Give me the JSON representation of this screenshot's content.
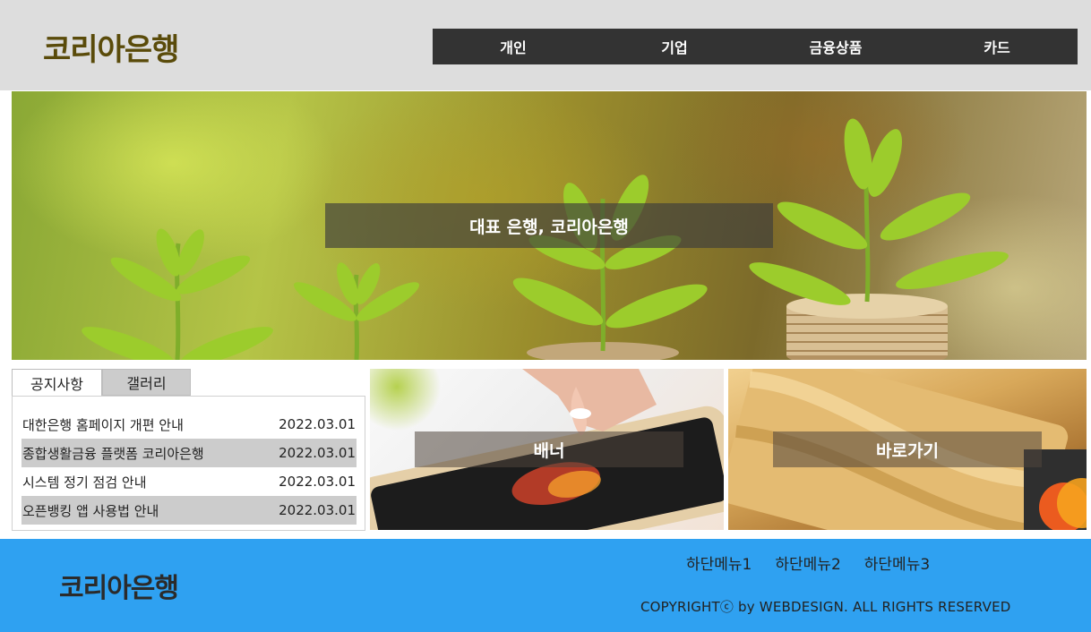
{
  "header": {
    "logo": "코리아은행",
    "logo_color": "#5a4b0a",
    "nav": [
      "개인",
      "기업",
      "금융상품",
      "카드"
    ]
  },
  "hero": {
    "caption": "대표 은행, 코리아은행"
  },
  "notice": {
    "tabs": [
      "공지사항",
      "갤러리"
    ],
    "items": [
      {
        "title": "대한은행 홈페이지 개편 안내",
        "date": "2022.03.01"
      },
      {
        "title": "종합생활금융 플랫폼 코리아은행",
        "date": "2022.03.01"
      },
      {
        "title": "시스템 정기 점검 안내",
        "date": "2022.03.01"
      },
      {
        "title": "오픈뱅킹 앱 사용법 안내",
        "date": "2022.03.01"
      }
    ]
  },
  "banners": {
    "banner_label": "배너",
    "shortcut_label": "바로가기"
  },
  "footer": {
    "logo": "코리아은행",
    "menu": [
      "하단메뉴1",
      "하단메뉴2",
      "하단메뉴3"
    ],
    "copyright": "COPYRIGHTⓒ by WEBDESIGN. ALL RIGHTS RESERVED",
    "bg_color": "#2fa1f1"
  }
}
